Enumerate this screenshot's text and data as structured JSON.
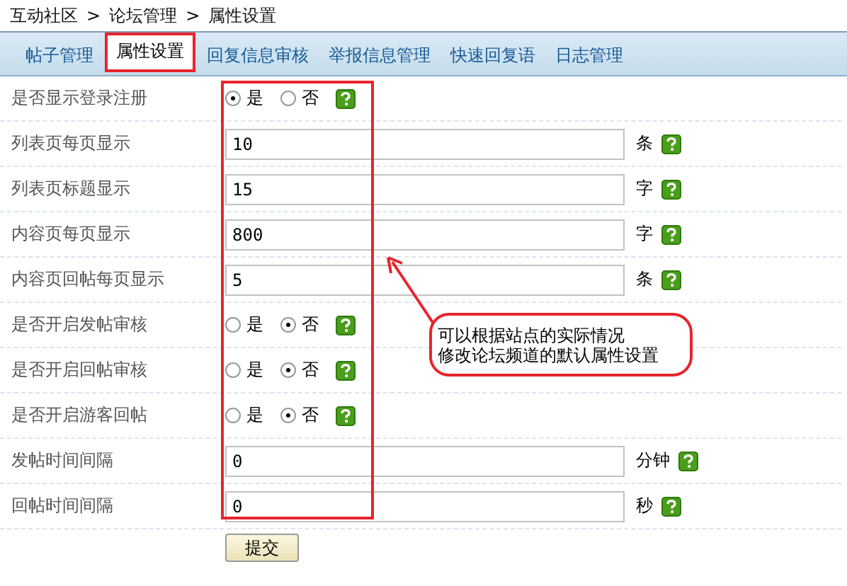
{
  "breadcrumb": [
    "互动社区",
    "论坛管理",
    "属性设置"
  ],
  "separator": ">",
  "tabs": [
    {
      "label": "帖子管理",
      "selected": false
    },
    {
      "label": "属性设置",
      "selected": true
    },
    {
      "label": "回复信息审核",
      "selected": false
    },
    {
      "label": "举报信息管理",
      "selected": false
    },
    {
      "label": "快速回复语",
      "selected": false
    },
    {
      "label": "日志管理",
      "selected": false
    }
  ],
  "rows": [
    {
      "label": "是否显示登录注册",
      "kind": "radio",
      "options": [
        {
          "label": "是",
          "selected": true
        },
        {
          "label": "否",
          "selected": false
        }
      ]
    },
    {
      "label": "列表页每页显示",
      "kind": "input",
      "value": "10",
      "unit": "条"
    },
    {
      "label": "列表页标题显示",
      "kind": "input",
      "value": "15",
      "unit": "字"
    },
    {
      "label": "内容页每页显示",
      "kind": "input",
      "value": "800",
      "unit": "字"
    },
    {
      "label": "内容页回帖每页显示",
      "kind": "input",
      "value": "5",
      "unit": "条"
    },
    {
      "label": "是否开启发帖审核",
      "kind": "radio",
      "options": [
        {
          "label": "是",
          "selected": false
        },
        {
          "label": "否",
          "selected": true
        }
      ]
    },
    {
      "label": "是否开启回帖审核",
      "kind": "radio",
      "options": [
        {
          "label": "是",
          "selected": false
        },
        {
          "label": "否",
          "selected": true
        }
      ]
    },
    {
      "label": "是否开启游客回帖",
      "kind": "radio",
      "options": [
        {
          "label": "是",
          "selected": false
        },
        {
          "label": "否",
          "selected": true
        }
      ]
    },
    {
      "label": "发帖时间间隔",
      "kind": "input",
      "value": "0",
      "unit": "分钟"
    },
    {
      "label": "回帖时间间隔",
      "kind": "input",
      "value": "0",
      "unit": "秒"
    }
  ],
  "submit": "提交",
  "callout": [
    "可以根据站点的实际情况",
    "修改论坛频道的默认属性设置"
  ]
}
